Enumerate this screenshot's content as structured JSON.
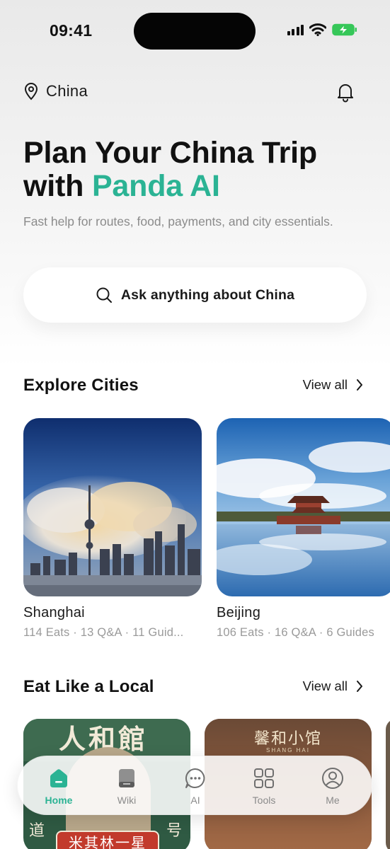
{
  "status_bar": {
    "time": "09:41"
  },
  "header": {
    "location": "China"
  },
  "hero": {
    "title_line1": "Plan Your China Trip",
    "title_line2_prefix": "with ",
    "title_line2_accent": "Panda AI",
    "subtitle": "Fast help for routes, food, payments, and city essentials."
  },
  "search": {
    "label": "Ask anything about China"
  },
  "cities": {
    "title": "Explore Cities",
    "view_all": "View all",
    "items": [
      {
        "name": "Shanghai",
        "stats": "114 Eats · 13 Q&A · 11 Guid..."
      },
      {
        "name": "Beijing",
        "stats": "106 Eats · 16 Q&A · 6 Guides"
      }
    ]
  },
  "eat": {
    "title": "Eat Like a Local",
    "view_all": "View all",
    "items": [
      {
        "sign_text": "人和館",
        "side_left": "道",
        "side_right": "号",
        "banner": "米其林一星"
      },
      {
        "sign_text": "馨和小馆",
        "sign_sub": "SHANG HAI"
      }
    ]
  },
  "tabbar": {
    "tabs": [
      {
        "label": "Home",
        "icon": "home-icon",
        "active": true
      },
      {
        "label": "Wiki",
        "icon": "book-icon",
        "active": false
      },
      {
        "label": "AI",
        "icon": "chat-icon",
        "active": false
      },
      {
        "label": "Tools",
        "icon": "grid-icon",
        "active": false
      },
      {
        "label": "Me",
        "icon": "user-icon",
        "active": false
      }
    ]
  },
  "colors": {
    "accent": "#2bb394",
    "text": "#111111",
    "muted": "#8b8b8b"
  }
}
